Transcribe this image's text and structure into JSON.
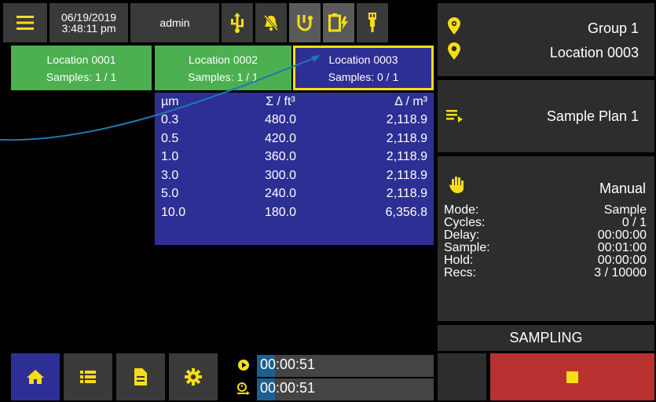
{
  "header": {
    "date": "06/19/2019",
    "time": "3:48:11 pm",
    "user": "admin",
    "icons": [
      "menu-icon",
      "usb-icon",
      "alarm-off-icon",
      "vacuum-icon",
      "battery-charging-icon",
      "light-icon"
    ]
  },
  "locations": [
    {
      "name": "Location 0001",
      "samples": "Samples: 1 / 1"
    },
    {
      "name": "Location 0002",
      "samples": "Samples: 1 / 1"
    },
    {
      "name": "Location 0003",
      "samples": "Samples: 0 / 1"
    }
  ],
  "table": {
    "headers": [
      "µm",
      "Σ / ft³",
      "Δ / m³"
    ],
    "rows": [
      [
        "0.3",
        "480.0",
        "2,118.9"
      ],
      [
        "0.5",
        "420.0",
        "2,118.9"
      ],
      [
        "1.0",
        "360.0",
        "2,118.9"
      ],
      [
        "3.0",
        "300.0",
        "2,118.9"
      ],
      [
        "5.0",
        "240.0",
        "2,118.9"
      ],
      [
        "10.0",
        "180.0",
        "6,356.8"
      ]
    ]
  },
  "panel": {
    "group": "Group 1",
    "location": "Location 0003",
    "plan": "Sample Plan 1",
    "manual": "Manual",
    "info": [
      {
        "label": "Mode:",
        "value": "Sample"
      },
      {
        "label": "Cycles:",
        "value": "0 / 1"
      },
      {
        "label": "Delay:",
        "value": "00:00:00"
      },
      {
        "label": "Sample:",
        "value": "00:01:00"
      },
      {
        "label": "Hold:",
        "value": "00:00:00"
      },
      {
        "label": "Recs:",
        "value": "3 / 10000"
      }
    ],
    "status": "SAMPLING"
  },
  "timers": {
    "elapsed": "00:00:51",
    "remaining": "00:00:51",
    "elapsed_fill": 0.1,
    "remaining_fill": 0.1
  },
  "colors": {
    "accent_yellow": "#f7dd16",
    "tile_green": "#4caf50",
    "selected_blue": "#2e2f94",
    "stop_red": "#b83232"
  }
}
